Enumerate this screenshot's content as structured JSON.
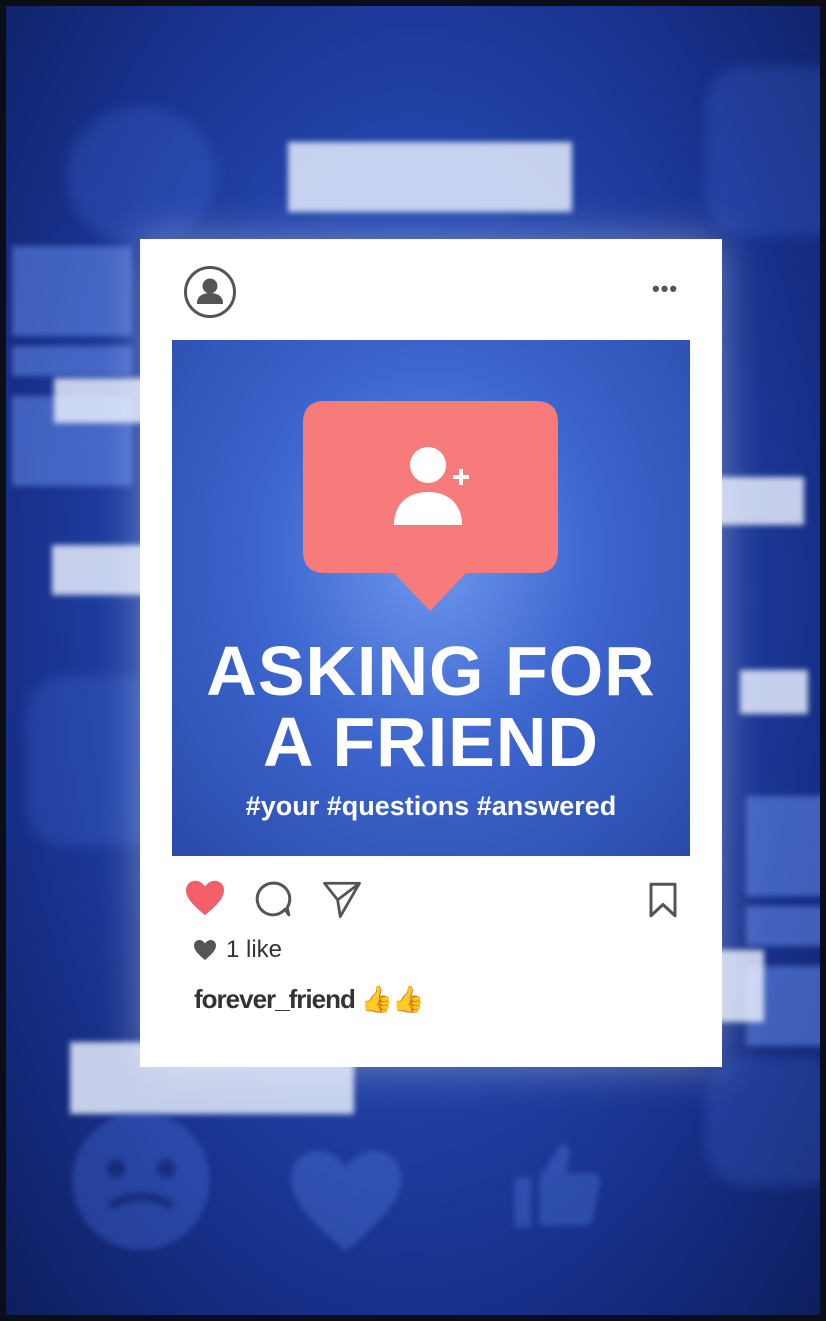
{
  "post": {
    "more_label": "•••",
    "headline_line1": "ASKING FOR",
    "headline_line2": "A FRIEND",
    "hashtags": "#your #questions #answered",
    "likes_text": "1 like",
    "caption_username": "forever_friend",
    "caption_emoji": "👍👍"
  },
  "colors": {
    "bubble": "#f77b7b",
    "heart": "#f25f6b",
    "background": "#2548b0"
  },
  "icons": [
    "user-avatar-icon",
    "more-options-icon",
    "add-user-icon",
    "heart-icon",
    "comment-icon",
    "share-icon",
    "bookmark-icon",
    "small-heart-icon",
    "thumbs-up-emoji"
  ]
}
